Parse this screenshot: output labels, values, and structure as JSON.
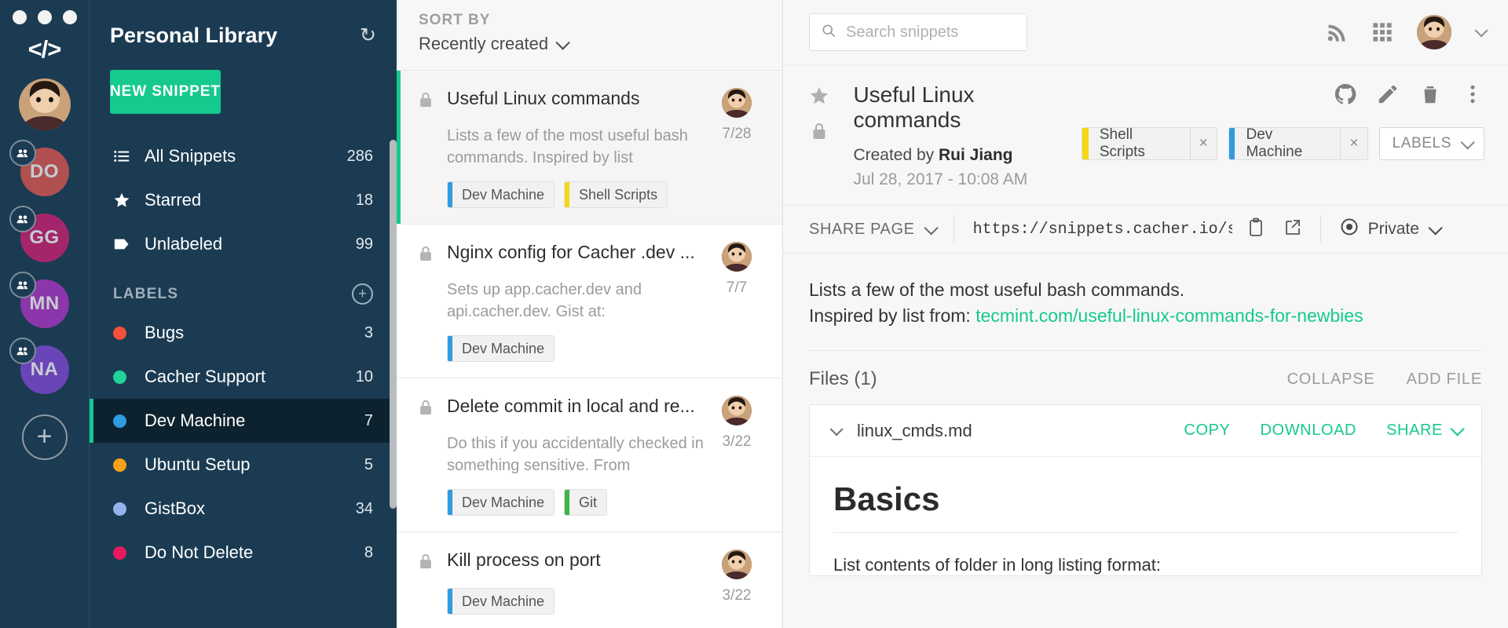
{
  "rail": {
    "logo_icon": "code-brackets-icon",
    "user_avatar": "user-avatar",
    "teams": [
      {
        "initials": "DO",
        "color": "#b05050"
      },
      {
        "initials": "GG",
        "color": "#a5256b"
      },
      {
        "initials": "MN",
        "color": "#8b36ab"
      },
      {
        "initials": "NA",
        "color": "#6a45b8"
      }
    ],
    "add_label": "+"
  },
  "sidebar": {
    "title": "Personal Library",
    "refresh_icon": "refresh-icon",
    "new_snippet_label": "NEW SNIPPET",
    "nav": [
      {
        "label": "All Snippets",
        "count": "286",
        "icon": "list-icon"
      },
      {
        "label": "Starred",
        "count": "18",
        "icon": "star-icon"
      },
      {
        "label": "Unlabeled",
        "count": "99",
        "icon": "tag-icon"
      }
    ],
    "labels_header": "LABELS",
    "add_label_icon": "plus-circle-icon",
    "labels": [
      {
        "label": "Bugs",
        "count": "3",
        "color": "#f4503c",
        "active": false
      },
      {
        "label": "Cacher Support",
        "count": "10",
        "color": "#20d39a",
        "active": false
      },
      {
        "label": "Dev Machine",
        "count": "7",
        "color": "#2f9be0",
        "active": true
      },
      {
        "label": "Ubuntu Setup",
        "count": "5",
        "color": "#f6a117",
        "active": false
      },
      {
        "label": "GistBox",
        "count": "34",
        "color": "#96b2ea",
        "active": false
      },
      {
        "label": "Do Not Delete",
        "count": "8",
        "color": "#e8195f",
        "active": false
      }
    ]
  },
  "list": {
    "sort_by_label": "SORT BY",
    "sort_value": "Recently created",
    "snippets": [
      {
        "title": "Useful Linux commands",
        "description": "Lists a few of the most useful bash commands. Inspired by list",
        "date": "7/28",
        "selected": true,
        "tags": [
          {
            "label": "Dev Machine",
            "color": "#2f9be0"
          },
          {
            "label": "Shell Scripts",
            "color": "#f6d713"
          }
        ]
      },
      {
        "title": "Nginx config for Cacher .dev ...",
        "description": "Sets up app.cacher.dev and api.cacher.dev. Gist at:",
        "date": "7/7",
        "selected": false,
        "tags": [
          {
            "label": "Dev Machine",
            "color": "#2f9be0"
          }
        ]
      },
      {
        "title": "Delete commit in local and re...",
        "description": "Do this if you accidentally checked in something sensitive. From",
        "date": "3/22",
        "selected": false,
        "tags": [
          {
            "label": "Dev Machine",
            "color": "#2f9be0"
          },
          {
            "label": "Git",
            "color": "#3cb44b"
          }
        ]
      },
      {
        "title": "Kill process on port",
        "description": "",
        "date": "3/22",
        "selected": false,
        "tags": [
          {
            "label": "Dev Machine",
            "color": "#2f9be0"
          }
        ]
      }
    ]
  },
  "topbar": {
    "search_placeholder": "Search snippets",
    "search_value": "",
    "search_icon": "search-icon",
    "rss_icon": "rss-icon",
    "apps_icon": "apps-grid-icon",
    "avatar": "user-avatar",
    "chevron": "chevron-down-icon"
  },
  "detail": {
    "star_icon": "star-icon",
    "lock_icon": "lock-icon",
    "title": "Useful Linux commands",
    "created_by_prefix": "Created by ",
    "author": "Rui Jiang",
    "created_date": "Jul 28, 2017 - 10:08 AM",
    "actions": [
      {
        "name": "github-icon"
      },
      {
        "name": "pencil-icon"
      },
      {
        "name": "trash-icon"
      },
      {
        "name": "more-vertical-icon"
      }
    ],
    "chips": [
      {
        "label": "Shell Scripts",
        "color": "#f6d713",
        "close": "×"
      },
      {
        "label": "Dev Machine",
        "color": "#2f9be0",
        "close": "×"
      }
    ],
    "labels_button": "LABELS",
    "share": {
      "share_page_label": "SHARE PAGE",
      "url": "https://snippets.cacher.io/snippet/",
      "copy_icon": "clipboard-icon",
      "open_icon": "external-link-icon",
      "privacy_icon": "eye-icon",
      "privacy_label": "Private"
    },
    "description_line1": "Lists a few of the most useful bash commands.",
    "description_line2_prefix": "Inspired by list from: ",
    "description_link": "tecmint.com/useful-linux-commands-for-newbies",
    "files_title": "Files (1)",
    "collapse_label": "COLLAPSE",
    "add_file_label": "ADD FILE",
    "file": {
      "name": "linux_cmds.md",
      "copy_label": "COPY",
      "download_label": "DOWNLOAD",
      "share_label": "SHARE",
      "heading": "Basics",
      "paragraph": "List contents of folder in long listing format:"
    }
  },
  "colors": {
    "accent_green": "#16c98d",
    "sidebar_bg": "#1b3b52",
    "active_row": "#0d222f"
  }
}
